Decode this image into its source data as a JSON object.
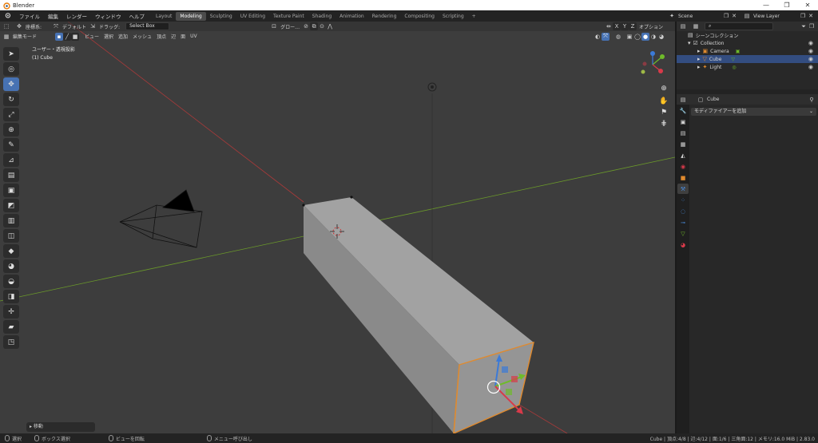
{
  "window": {
    "title": "Blender",
    "controls": [
      "—",
      "❐",
      "✕"
    ]
  },
  "menu": {
    "items": [
      "ファイル",
      "編集",
      "レンダー",
      "ウィンドウ",
      "ヘルプ"
    ]
  },
  "workspaces": {
    "tabs": [
      "Layout",
      "Modeling",
      "Sculpting",
      "UV Editing",
      "Texture Paint",
      "Shading",
      "Animation",
      "Rendering",
      "Compositing",
      "Scripting",
      "+"
    ],
    "active": "Modeling"
  },
  "topright": {
    "scene": "Scene",
    "view_layer": "View Layer"
  },
  "viewport_header": {
    "transform_label": "座標系:",
    "orientation": "デフォルト",
    "drag": "ドラッグ:",
    "select_box": "Select Box",
    "pivot": "グロー…",
    "axes": [
      "X",
      "Y",
      "Z"
    ],
    "options": "オプション"
  },
  "viewport_header2": {
    "mode": "編集モード",
    "menus": [
      "ビュー",
      "選択",
      "追加",
      "メッシュ",
      "頂点",
      "辺",
      "面",
      "UV"
    ]
  },
  "viewport": {
    "view_name": "ユーザー・透視投影",
    "object_name": "(1) Cube"
  },
  "operator_panel": {
    "label": "移動"
  },
  "statusbar": {
    "items": [
      "選択",
      "ボックス選択",
      "ビューを回転",
      "メニュー呼び出し"
    ],
    "stats": "Cube | 頂点:4/8 | 辺:4/12 | 面:1/6 | 三角面:12 | メモリ:16.0 MiB | 2.83.0"
  },
  "outliner": {
    "root": "シーンコレクション",
    "collection": "Collection",
    "objects": [
      {
        "name": "Camera",
        "selected": false
      },
      {
        "name": "Cube",
        "selected": true
      },
      {
        "name": "Light",
        "selected": false
      }
    ]
  },
  "properties": {
    "object": "Cube",
    "add_modifier": "モディファイアーを追加"
  },
  "colors": {
    "accent": "#4772b3",
    "viewport_bg": "#3d3d3d",
    "x_axis": "#c83c3c",
    "y_axis": "#6b9a2a",
    "selected_edge": "#e08a2e"
  }
}
